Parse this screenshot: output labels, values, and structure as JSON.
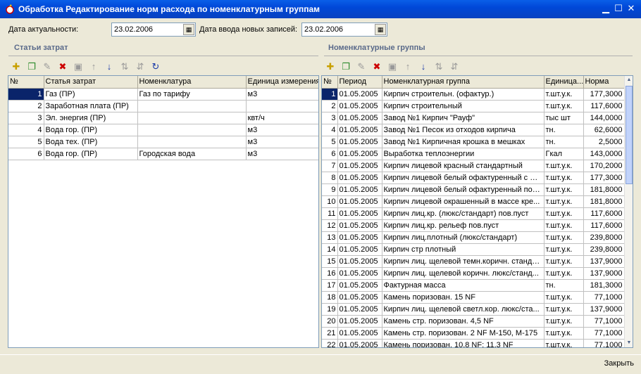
{
  "window": {
    "title": "Обработка  Редактирование норм расхода по номенклатурным группам"
  },
  "header": {
    "actual_date_label": "Дата актуальности:",
    "actual_date_value": "23.02.2006",
    "entry_date_label": "Дата ввода новых записей:",
    "entry_date_value": "23.02.2006"
  },
  "left": {
    "title": "Статьи затрат",
    "columns": [
      "№",
      "Статья затрат",
      "Номенклатура",
      "Единица измерения"
    ],
    "rows": [
      [
        "1",
        "Газ (ПР)",
        "Газ по тарифу",
        "м3"
      ],
      [
        "2",
        "Заработная плата (ПР)",
        "",
        ""
      ],
      [
        "3",
        "Эл. энергия (ПР)",
        "",
        "квт/ч"
      ],
      [
        "4",
        "Вода гор. (ПР)",
        "",
        "м3"
      ],
      [
        "5",
        "Вода тех. (ПР)",
        "",
        "м3"
      ],
      [
        "6",
        "Вода гор. (ПР)",
        "Городская вода",
        "м3"
      ]
    ]
  },
  "right": {
    "title": "Номенклатурные группы",
    "columns": [
      "№",
      "Период",
      "Номенклатурная группа",
      "Единица...",
      "Норма"
    ],
    "rows": [
      [
        "1",
        "01.05.2005",
        "Кирпич строительн. (офактур.)",
        "т.шт.у.к.",
        "177,3000"
      ],
      [
        "2",
        "01.05.2005",
        "Кирпич строительный",
        "т.шт.у.к.",
        "117,6000"
      ],
      [
        "3",
        "01.05.2005",
        "Завод №1 Кирпич  \"Рауф\"",
        "тыс шт",
        "144,0000"
      ],
      [
        "4",
        "01.05.2005",
        "Завод №1 Песок из отходов кирпича",
        "тн.",
        "62,6000"
      ],
      [
        "5",
        "01.05.2005",
        "Завод №1 Кирпичная крошка в мешках",
        "тн.",
        "2,5000"
      ],
      [
        "6",
        "01.05.2005",
        "Выработка теплоэнергии",
        "Гкал",
        "143,0000"
      ],
      [
        "7",
        "01.05.2005",
        "Кирпич лицевой красный стандартный",
        "т.шт.у.к.",
        "170,2000"
      ],
      [
        "8",
        "01.05.2005",
        "Кирпич лицевой белый офактуренный с ф...",
        "т.шт.у.к.",
        "177,3000"
      ],
      [
        "9",
        "01.05.2005",
        "Кирпич лицевой белый офактуренный пов...",
        "т.шт.у.к.",
        "181,8000"
      ],
      [
        "10",
        "01.05.2005",
        "Кирпич лицевой окрашенный в массе кре...",
        "т.шт.у.к.",
        "181,8000"
      ],
      [
        "11",
        "01.05.2005",
        "Кирпич лиц.кр. (люкс/стандарт) пов.пуст",
        "т.шт.у.к.",
        "117,6000"
      ],
      [
        "12",
        "01.05.2005",
        "Кирпич лиц.кр. рельеф пов.пуст",
        "т.шт.у.к.",
        "117,6000"
      ],
      [
        "13",
        "01.05.2005",
        "Кирпич лиц.плотный (люкс/стандарт)",
        "т.шт.у.к.",
        "239,8000"
      ],
      [
        "14",
        "01.05.2005",
        "Кирпич стр плотный",
        "т.шт.у.к.",
        "239,8000"
      ],
      [
        "15",
        "01.05.2005",
        "Кирпич лиц. щелевой темн.коричн. стандарт",
        "т.шт.у.к.",
        "137,9000"
      ],
      [
        "16",
        "01.05.2005",
        "Кирпич лиц. щелевой коричн. люкс/станд...",
        "т.шт.у.к.",
        "137,9000"
      ],
      [
        "17",
        "01.05.2005",
        "Фактурная масса",
        "тн.",
        "181,3000"
      ],
      [
        "18",
        "01.05.2005",
        "Камень поризован. 15 NF",
        "т.шт.у.к.",
        "77,1000"
      ],
      [
        "19",
        "01.05.2005",
        "Кирпич лиц. щелевой светл.кор. люкс/ста...",
        "т.шт.у.к.",
        "137,9000"
      ],
      [
        "20",
        "01.05.2005",
        "Камень стр. поризован. 4,5 NF",
        "т.шт.у.к.",
        "77,1000"
      ],
      [
        "21",
        "01.05.2005",
        "Камень стр. поризован. 2 NF М-150, М-175",
        "т.шт.у.к.",
        "77,1000"
      ],
      [
        "22",
        "01.05.2005",
        "Камень поризован. 10,8 NF; 11,3 NF",
        "т.шт.у.к.",
        "77,1000"
      ]
    ]
  },
  "footer": {
    "close_label": "Закрыть"
  }
}
